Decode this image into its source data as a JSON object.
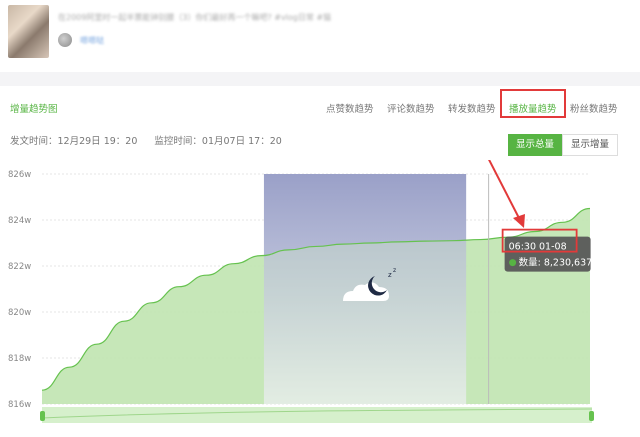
{
  "post": {
    "title": "在2009阿里时一起半票能钟别腰（3）你们最好再一个嘛吧? #vlog日常 #猫",
    "author": "嗯嗯哒"
  },
  "section": {
    "title": "增量趋势图"
  },
  "tabs": [
    {
      "label": "点赞数趋势",
      "active": false
    },
    {
      "label": "评论数趋势",
      "active": false
    },
    {
      "label": "转发数趋势",
      "active": false
    },
    {
      "label": "播放量趋势",
      "active": true
    },
    {
      "label": "粉丝数趋势",
      "active": false
    }
  ],
  "meta": {
    "publish_time": "发文时间：12月29日 19：20",
    "monitor_time": "监控时间：01月07日 17：20"
  },
  "buttons": {
    "total": "显示总量",
    "increment": "显示增量"
  },
  "tooltip": {
    "time": "06:30 01-08",
    "label": "数量: 8,230,637"
  },
  "colors": {
    "accent": "#57b443",
    "line": "#66c24f",
    "area": "#b7e3a6",
    "highlight": "#e23a3a",
    "night_top": "#9aa0c8"
  },
  "icons": {
    "night": "moon-cloud-sleep-icon"
  },
  "chart_data": {
    "type": "area",
    "y_ticks": [
      "826w",
      "824w",
      "822w",
      "820w",
      "818w",
      "816w"
    ],
    "ylim": [
      816,
      826
    ],
    "xlim": [
      0,
      100
    ],
    "x": [
      0,
      5,
      10,
      15,
      20,
      25,
      30,
      35,
      40,
      45,
      50,
      55,
      60,
      65,
      70,
      75,
      80,
      85,
      90,
      95,
      100
    ],
    "values": [
      816.6,
      817.6,
      818.6,
      819.6,
      820.4,
      821.1,
      821.6,
      822.1,
      822.45,
      822.7,
      822.85,
      822.95,
      823.0,
      823.05,
      823.08,
      823.1,
      823.15,
      823.25,
      823.5,
      823.9,
      824.5
    ],
    "night_band": [
      40.5,
      77.4
    ],
    "cursor_x": 81.5,
    "tooltip_value": 823.06,
    "grid": true
  }
}
